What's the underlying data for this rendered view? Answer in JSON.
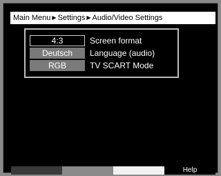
{
  "breadcrumb": {
    "items": [
      "Main Menu",
      "Settings",
      "Audio/Video Settings"
    ],
    "separator": "▶"
  },
  "menu": {
    "rows": [
      {
        "value": "4:3",
        "label": "Screen format",
        "selected": true
      },
      {
        "value": "Deutsch",
        "label": "Language (audio)",
        "selected": false
      },
      {
        "value": "RGB",
        "label": "TV SCART Mode",
        "selected": false
      }
    ]
  },
  "bottom_bar": {
    "red_label": "",
    "green_label": "",
    "yellow_label": "",
    "blue_label": "Help"
  },
  "colors": {
    "background": "#000000",
    "header": "#ffffff",
    "value_box": "#7a7a7a",
    "text": "#ffffff"
  }
}
